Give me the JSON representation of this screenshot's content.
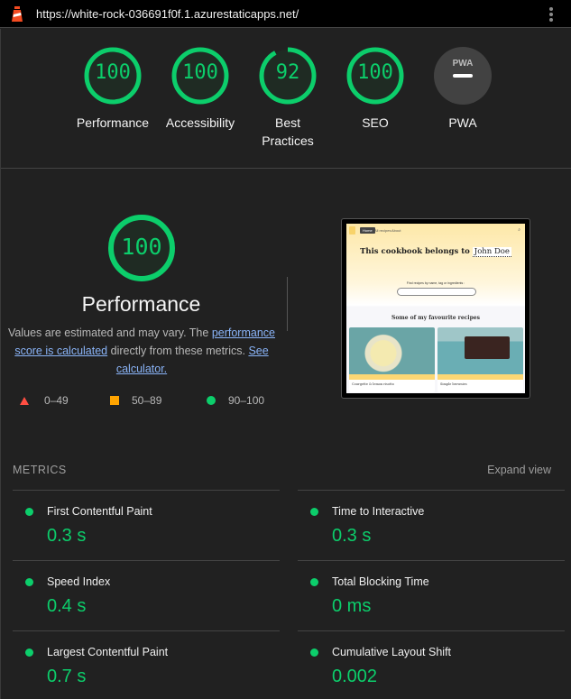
{
  "topbar": {
    "url": "https://white-rock-036691f0f.1.azurestaticapps.net/",
    "app_icon": "lighthouse-icon",
    "menu_icon": "kebab-menu-icon"
  },
  "categories": [
    {
      "label": "Performance",
      "score": "100",
      "fraction": 1.0
    },
    {
      "label": "Accessibility",
      "score": "100",
      "fraction": 1.0
    },
    {
      "label": "Best Practices",
      "score": "92",
      "fraction": 0.92
    },
    {
      "label": "SEO",
      "score": "100",
      "fraction": 1.0
    },
    {
      "label": "PWA",
      "badge": "PWA",
      "icon": "pwa-badge-icon"
    }
  ],
  "performance": {
    "score": "100",
    "fraction": 1.0,
    "title": "Performance",
    "desc_prefix": "Values are estimated and may vary. The ",
    "link1": "performance score is calculated",
    "desc_mid": " directly from these metrics. ",
    "link2": "See calculator.",
    "legend": [
      {
        "icon": "fail-triangle-icon",
        "range": "0–49"
      },
      {
        "icon": "average-square-icon",
        "range": "50–89"
      },
      {
        "icon": "pass-circle-icon",
        "range": "90–100"
      }
    ]
  },
  "screenshot": {
    "nav": [
      "Home",
      "All recipes",
      "About"
    ],
    "heading": "This cookbook belongs to",
    "owner": "John Doe",
    "search_label": "Find recipes by name, tag or ingredients :",
    "section_title": "Some of my favourite recipes",
    "cards": [
      "Courgette & lemon risotto",
      "Simple brownies"
    ]
  },
  "metrics": {
    "header": "METRICS",
    "expand": "Expand view",
    "items": [
      {
        "name": "First Contentful Paint",
        "value": "0.3 s"
      },
      {
        "name": "Time to Interactive",
        "value": "0.3 s"
      },
      {
        "name": "Speed Index",
        "value": "0.4 s"
      },
      {
        "name": "Total Blocking Time",
        "value": "0 ms"
      },
      {
        "name": "Largest Contentful Paint",
        "value": "0.7 s"
      },
      {
        "name": "Cumulative Layout Shift",
        "value": "0.002"
      }
    ]
  },
  "colors": {
    "pass": "#0cce6b",
    "average": "#ffa400",
    "fail": "#ff4e42",
    "link": "#8ab4f8"
  }
}
